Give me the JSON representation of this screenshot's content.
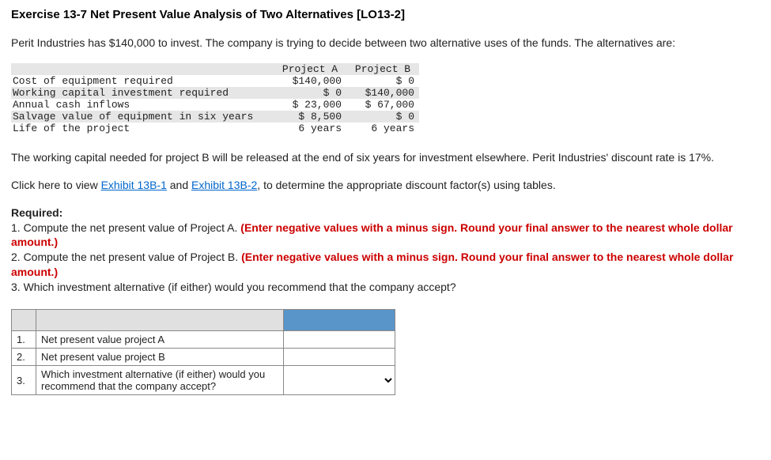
{
  "title": "Exercise 13-7 Net Present Value Analysis of Two Alternatives [LO13-2]",
  "intro": "Perit Industries has $140,000 to invest. The company is trying to decide between two alternative uses of the funds. The alternatives are:",
  "table": {
    "header_a": "Project A",
    "header_b": "Project B",
    "rows": [
      {
        "label": "Cost of equipment required",
        "a": "$140,000",
        "b": "$      0"
      },
      {
        "label": "Working capital investment required",
        "a": "$      0",
        "b": "$140,000"
      },
      {
        "label": "Annual cash inflows",
        "a": "$ 23,000",
        "b": "$ 67,000"
      },
      {
        "label": "Salvage value of equipment in six years",
        "a": "$  8,500",
        "b": "$      0"
      },
      {
        "label": "Life of the project",
        "a": "6 years",
        "b": "6 years"
      }
    ]
  },
  "mid_para": "The working capital needed for project B will be released at the end of six years for investment elsewhere. Perit Industries' discount rate is 17%.",
  "click_prefix": "Click here to view ",
  "link1": "Exhibit 13B-1",
  "link_mid": " and ",
  "link2": "Exhibit 13B-2",
  "click_suffix": ", to determine the appropriate discount factor(s) using tables.",
  "required_label": "Required:",
  "req1_a": "1. Compute the net present value of Project A. ",
  "req1_b": "(Enter negative values with a minus sign. Round your final answer to the nearest whole dollar amount.)",
  "req2_a": "2. Compute the net present value of Project B. ",
  "req2_b": "(Enter negative values with a minus sign. Round your final answer to the nearest whole dollar amount.)",
  "req3": "3. Which investment alternative (if either) would you recommend that the company accept?",
  "answer": {
    "r1": {
      "n": "1.",
      "label": "Net present value project A"
    },
    "r2": {
      "n": "2.",
      "label": "Net present value project B"
    },
    "r3": {
      "n": "3.",
      "label": "Which investment alternative (if either) would you recommend that the company accept?"
    }
  }
}
